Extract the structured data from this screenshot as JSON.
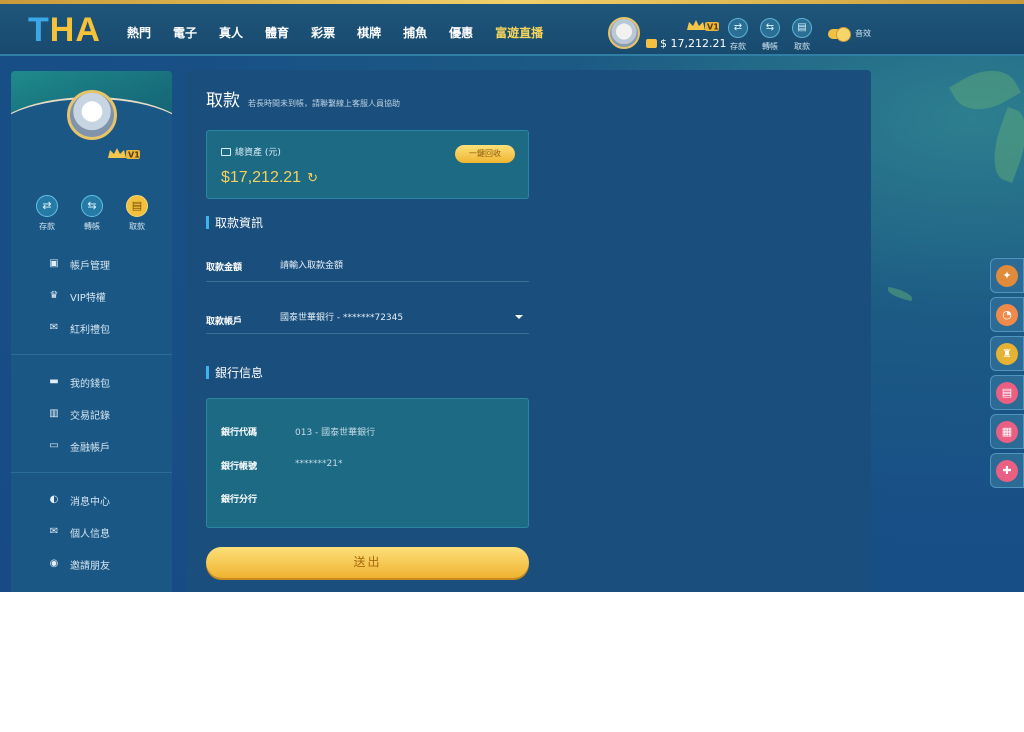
{
  "brand": {
    "logo_t": "T",
    "logo_ha": "HA"
  },
  "header": {
    "nav": [
      "熱門",
      "電子",
      "真人",
      "體育",
      "彩票",
      "棋牌",
      "捕魚",
      "優惠",
      "富遊直播"
    ],
    "balance": "$ 17,212.21",
    "vip": "V1",
    "actions": [
      {
        "label": "存款",
        "icon": "deposit-icon",
        "glyph": "⇄"
      },
      {
        "label": "轉帳",
        "icon": "transfer-icon",
        "glyph": "⇆"
      },
      {
        "label": "取款",
        "icon": "withdraw-icon",
        "glyph": "▤"
      }
    ],
    "sound_label": "音效"
  },
  "sidebar": {
    "vip": "V1",
    "quick_actions": [
      {
        "label": "存款",
        "glyph": "⇄"
      },
      {
        "label": "轉帳",
        "glyph": "⇆"
      },
      {
        "label": "取款",
        "glyph": "▤"
      }
    ],
    "group1": [
      {
        "label": "帳戶管理",
        "glyph": "▣"
      },
      {
        "label": "VIP特權",
        "glyph": "♛"
      },
      {
        "label": "紅利禮包",
        "glyph": "✉"
      }
    ],
    "group2": [
      {
        "label": "我的錢包",
        "glyph": "▬"
      },
      {
        "label": "交易記錄",
        "glyph": "▥"
      },
      {
        "label": "金融帳戶",
        "glyph": "▭"
      }
    ],
    "group3": [
      {
        "label": "消息中心",
        "glyph": "◐"
      },
      {
        "label": "個人信息",
        "glyph": "✉"
      },
      {
        "label": "邀請朋友",
        "glyph": "◉"
      }
    ]
  },
  "main": {
    "title": "取款",
    "note": "若長時間未到帳，請聯繫線上客服人員協助",
    "assets_label": "總資產 (元)",
    "assets_amount": "$17,212.21",
    "recover_button": "一鍵回收",
    "section_withdraw": "取款資訊",
    "amount_label": "取款金額",
    "amount_placeholder": "請輸入取款金額",
    "account_label": "取款帳戶",
    "account_value": "國泰世華銀行 - *******72345",
    "section_bank": "銀行信息",
    "bank_code_label": "銀行代碼",
    "bank_code_value": "013 - 國泰世華銀行",
    "bank_no_label": "銀行帳號",
    "bank_no_value": "*******21*",
    "bank_branch_label": "銀行分行",
    "bank_branch_value": "",
    "submit": "送出"
  },
  "float_buttons": [
    {
      "icon": "gift-box-icon",
      "color": "#e08b3a"
    },
    {
      "icon": "support-icon",
      "color": "#ef8a4a"
    },
    {
      "icon": "trophy-icon",
      "color": "#e6b233"
    },
    {
      "icon": "ticket-icon",
      "color": "#ea5f82"
    },
    {
      "icon": "calendar-icon",
      "color": "#ea5f82"
    },
    {
      "icon": "user-add-icon",
      "color": "#ea5f82"
    }
  ]
}
